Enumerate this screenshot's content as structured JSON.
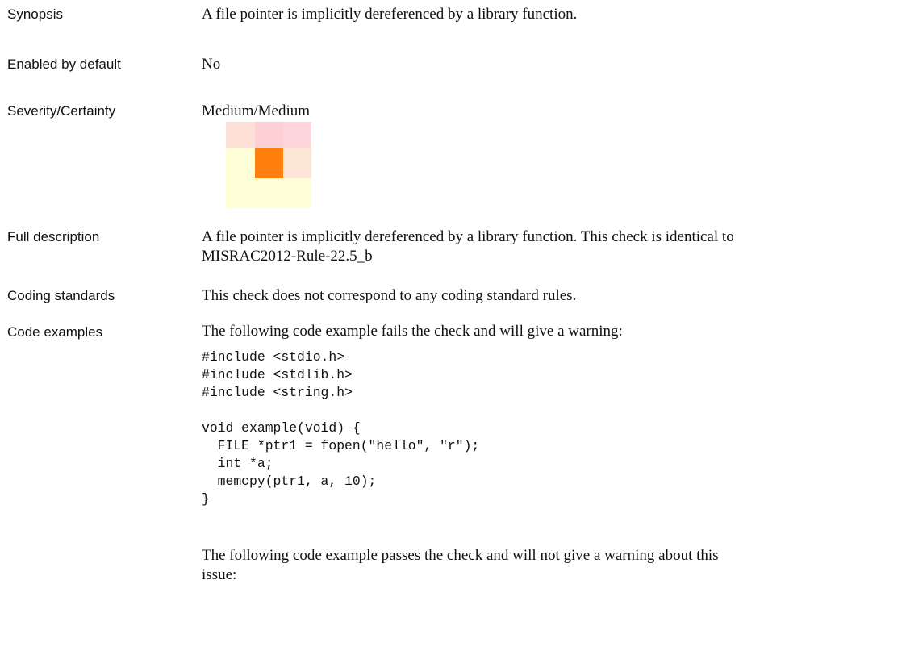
{
  "rows": {
    "synopsis": {
      "label": "Synopsis",
      "text": "A file pointer is implicitly dereferenced by a library function."
    },
    "enabled": {
      "label": "Enabled by default",
      "text": "No"
    },
    "severity": {
      "label": "Severity/Certainty",
      "text": "Medium/Medium"
    },
    "full_description": {
      "label": "Full description",
      "line1": "A file pointer is implicitly dereferenced by a library function. This check is identical to",
      "line2": "MISRAC2012-Rule-22.5_b"
    },
    "coding_standards": {
      "label": "Coding standards",
      "text": "This check does not correspond to any coding standard rules."
    },
    "code_examples": {
      "label": "Code examples",
      "fail_intro": "The following code example fails the check and will give a warning:",
      "code": "#include <stdio.h>\n#include <stdlib.h>\n#include <string.h>\n\nvoid example(void) {\n  FILE *ptr1 = fopen(\"hello\", \"r\");\n  int *a;\n  memcpy(ptr1, a, 10);\n}",
      "pass_intro_line1": "The following code example passes the check and will not give a warning about this",
      "pass_intro_line2": "issue:"
    }
  },
  "severity_matrix": {
    "highlighted": "Medium/Medium",
    "cells": [
      [
        "#fde1d6",
        "#fdd0d6",
        "#fdd4d9"
      ],
      [
        "#fffed6",
        "#ff7f0f",
        "#fde6d6"
      ],
      [
        "#fffed6",
        "#fffed6",
        "#fffed6"
      ]
    ]
  }
}
